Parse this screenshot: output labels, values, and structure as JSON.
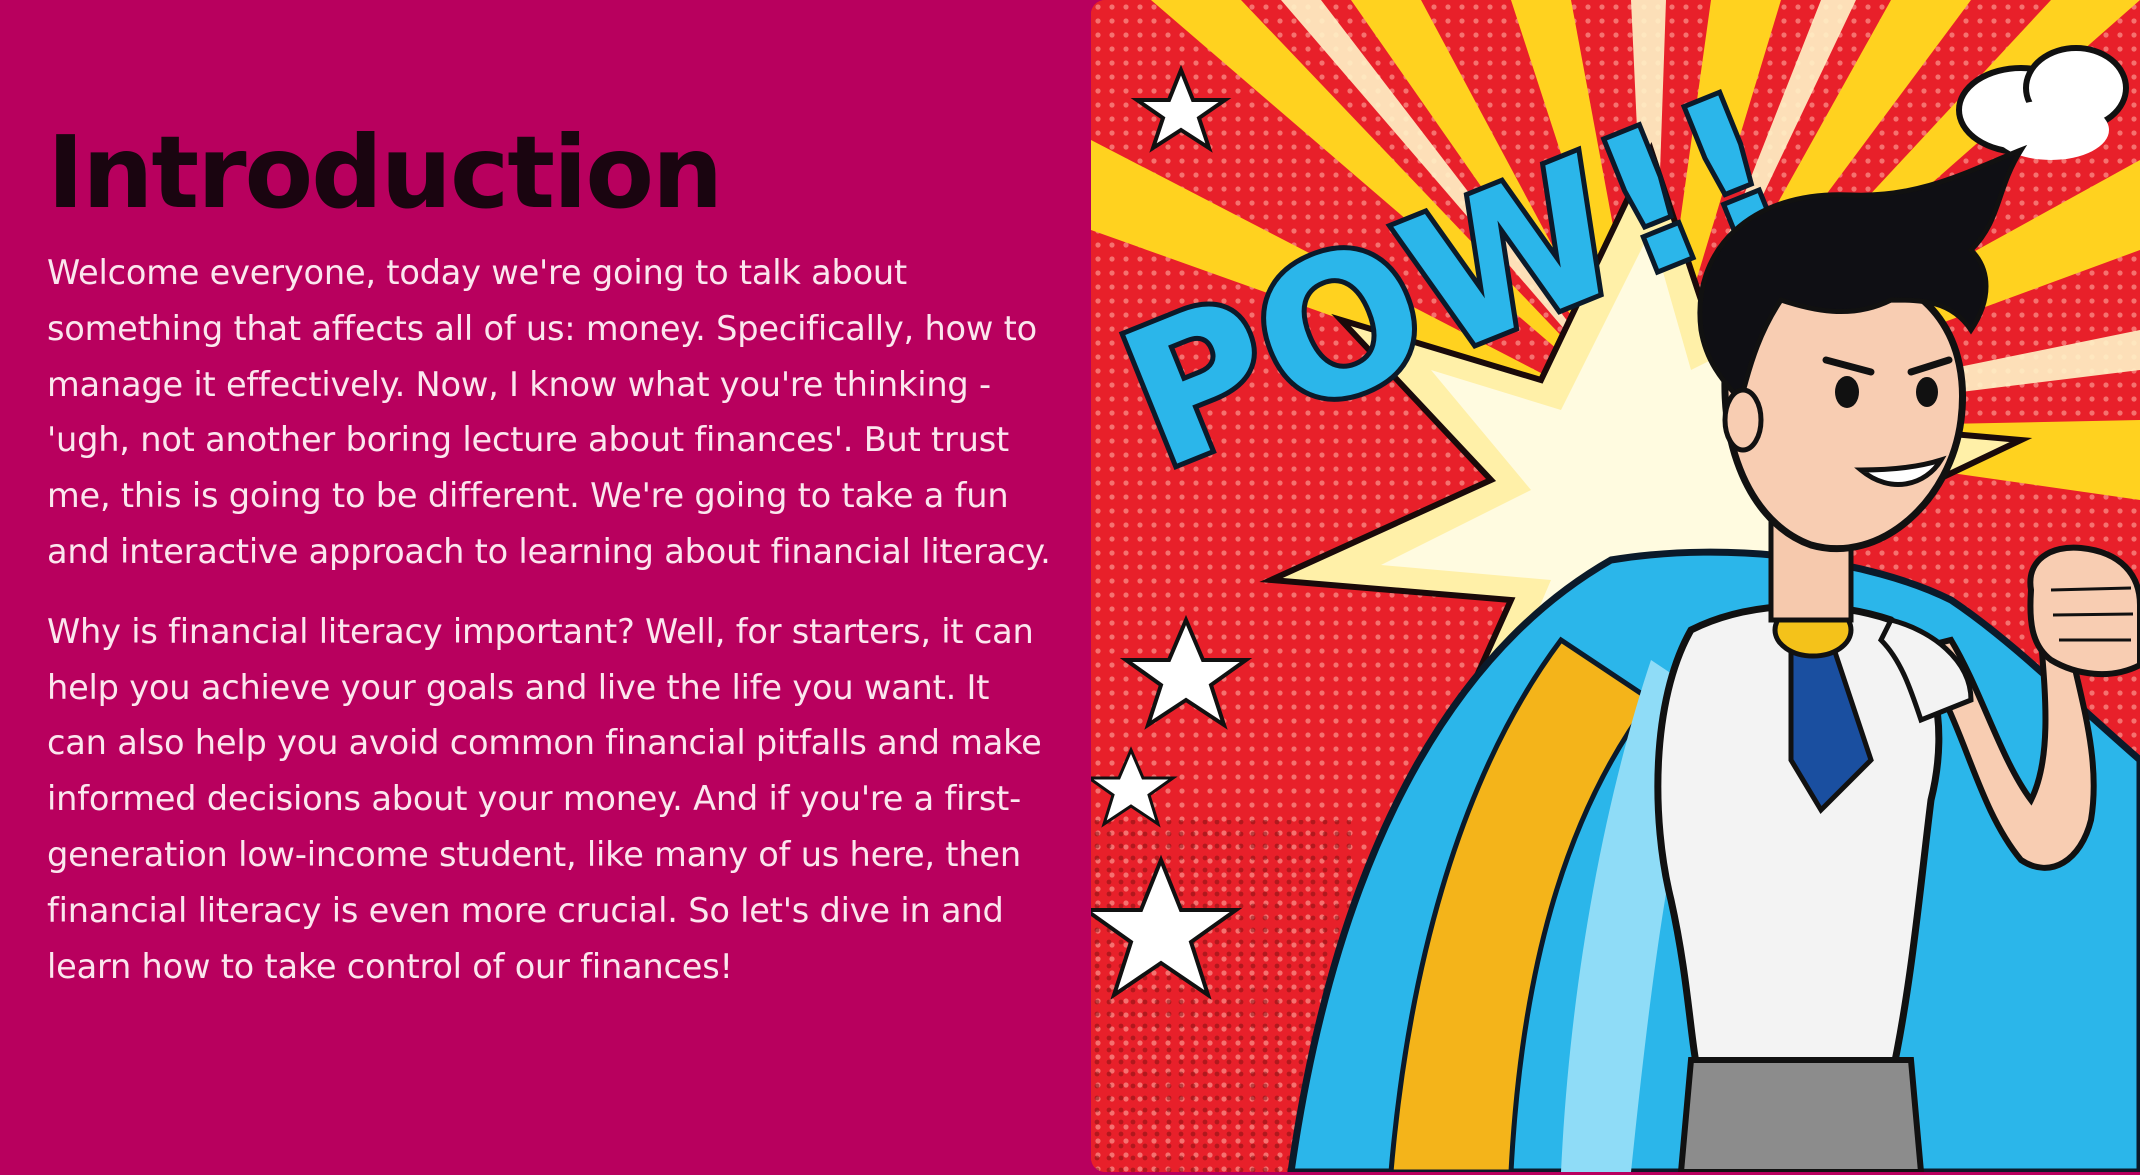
{
  "slide": {
    "title": "Introduction",
    "paragraphs": [
      "Welcome everyone, today we're going to talk about something that affects all of us: money. Specifically, how to manage it effectively. Now, I know what you're thinking - 'ugh, not another boring lecture about finances'. But trust me, this is going to be different. We're going to take a fun and interactive approach to learning about financial literacy.",
      "Why is financial literacy important? Well, for starters, it can help you achieve your goals and live the life you want. It can also help you avoid common financial pitfalls and make informed decisions about your money. And if you're a first-generation low-income student, like many of us here, then financial literacy is even more crucial. So let's dive in and learn how to take control of our finances!"
    ],
    "image": {
      "caption_text": "POW!!",
      "subject": "comic-superhero-with-cape"
    }
  },
  "colors": {
    "background": "#b8005e",
    "title": "#1a0510",
    "body_text": "#fbe6ee",
    "comic_red": "#e8202a",
    "comic_yellow": "#ffd21f",
    "comic_blue": "#2bb6ea"
  }
}
